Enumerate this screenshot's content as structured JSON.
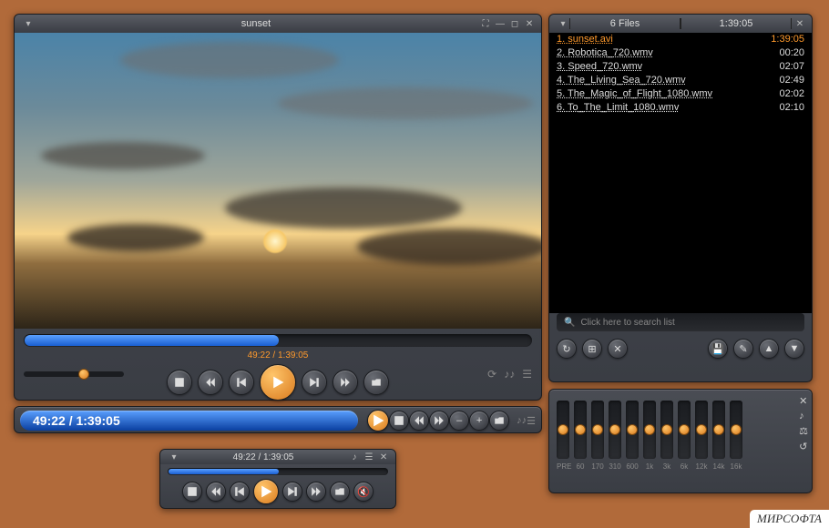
{
  "player": {
    "title": "sunset",
    "current_time": "49:22",
    "total_time": "1:39:05",
    "time_display": "49:22 / 1:39:05"
  },
  "playlist": {
    "header_left": "6 Files",
    "header_right": "1:39:05",
    "search_placeholder": "Click here to search list",
    "items": [
      {
        "label": "1. sunset.avi",
        "dur": "1:39:05",
        "active": true
      },
      {
        "label": "2. Robotica_720.wmv",
        "dur": "00:20",
        "active": false
      },
      {
        "label": "3. Speed_720.wmv",
        "dur": "02:07",
        "active": false
      },
      {
        "label": "4. The_Living_Sea_720.wmv",
        "dur": "02:49",
        "active": false
      },
      {
        "label": "5. The_Magic_of_Flight_1080.wmv",
        "dur": "02:02",
        "active": false
      },
      {
        "label": "6. To_The_Limit_1080.wmv",
        "dur": "02:10",
        "active": false
      }
    ]
  },
  "compact": {
    "time_display": "49:22 / 1:39:05"
  },
  "mini": {
    "time_display": "49:22 / 1:39:05"
  },
  "equalizer": {
    "bands": [
      "PRE",
      "60",
      "170",
      "310",
      "600",
      "1k",
      "3k",
      "6k",
      "12k",
      "14k",
      "16k"
    ]
  },
  "watermark": "МИРСОФТА"
}
